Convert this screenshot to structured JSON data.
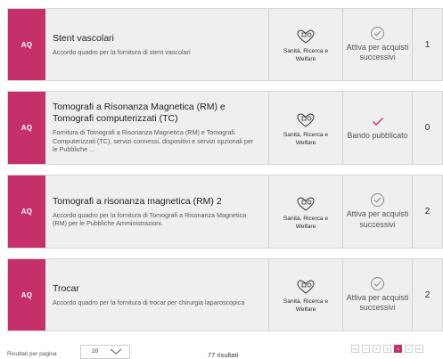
{
  "tenders": [
    {
      "tag": "AQ",
      "title": "Stent vascolari",
      "description": "Accordo quadro per la fornitura di stent vascolari",
      "area": "Sanità, Ricerca e Welfare",
      "status": "Attiva per acquisti successivi",
      "status_icon": "check-circle-icon",
      "count": "1"
    },
    {
      "tag": "AQ",
      "title": "Tomografi a Risonanza Magnetica (RM) e Tomografi computerizzati (TC)",
      "description": "Fornitura di Tomografi a Risonanza Magnetica (RM) e Tomografi Computerizzati (TC), servizi connessi, dispositivi e servizi opzionali per le Pubbliche ...",
      "area": "Sanità, Ricerca e Welfare",
      "status": "Bando pubblicato",
      "status_icon": "check-mark-icon",
      "count": "0"
    },
    {
      "tag": "AQ",
      "title": "Tomografi a risonanza magnetica (RM) 2",
      "description": "Accordo quadro per la fornitura di Tomografi a Risonanza Magnetica (RM) per le Pubbliche Amministrazioni.",
      "area": "Sanità, Ricerca e Welfare",
      "status": "Attiva per acquisti successivi",
      "status_icon": "check-circle-icon",
      "count": "2"
    },
    {
      "tag": "AQ",
      "title": "Trocar",
      "description": "Accordo quadro per la fornitura di trocar per chirurgia laparoscopica",
      "area": "Sanità, Ricerca e Welfare",
      "status": "Attiva per acquisti successivi",
      "status_icon": "check-circle-icon",
      "count": "2"
    }
  ],
  "footer": {
    "per_page_label": "Risultati per pagina",
    "per_page_value": "20",
    "results": "77 risultati",
    "pages": [
      "<<",
      "<",
      "2",
      "3",
      "4",
      ">",
      ">>"
    ],
    "current_page": "4"
  },
  "colors": {
    "accent": "#c5306a",
    "card_bg": "#f0eff0"
  }
}
